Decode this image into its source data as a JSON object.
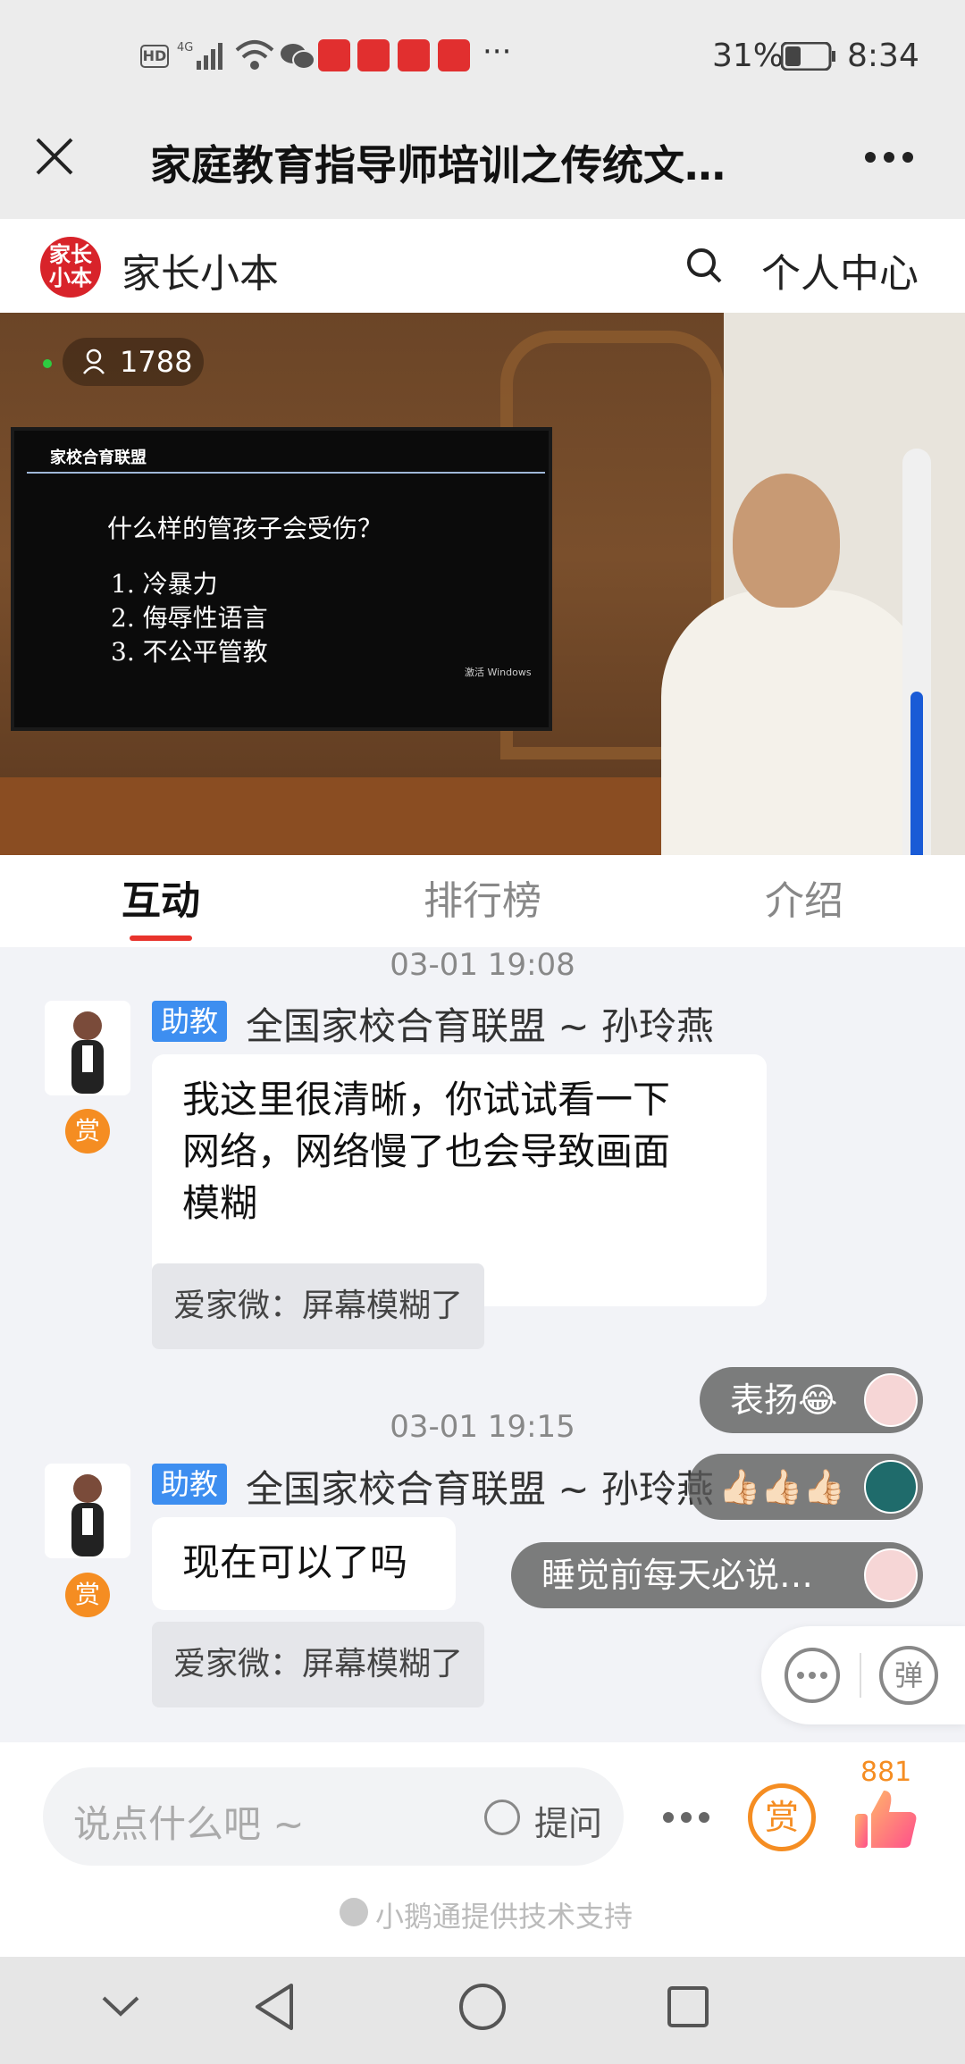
{
  "status": {
    "battery": "31%",
    "time": "8:34",
    "more": "···",
    "hd": "HD",
    "net": "4G"
  },
  "titlebar": {
    "title": "家庭教育指导师培训之传统文…"
  },
  "app": {
    "name": "家长小本",
    "logo_text": "家长\n小本",
    "personal_center": "个人中心"
  },
  "video": {
    "viewer_count": "1788",
    "tv_brand": "家校合育联盟",
    "slide_question": "什么样的管孩子会受伤？",
    "slide_items": [
      "1. 冷暴力",
      "2. 侮辱性语言",
      "3. 不公平管教"
    ],
    "watermark": "激活 Windows"
  },
  "tabs": [
    {
      "label": "互动",
      "active": true
    },
    {
      "label": "排行榜",
      "active": false
    },
    {
      "label": "介绍",
      "active": false
    }
  ],
  "chat": {
    "messages": [
      {
        "timestamp": "03-01 19:08",
        "role": "助教",
        "sender": "全国家校合育联盟 ~ 孙玲燕",
        "reward": "赏",
        "text": [
          "我这里很清晰，你试试看一下",
          "网络，网络慢了也会导致画面",
          "模糊"
        ],
        "quote": "爱家微：屏幕模糊了"
      },
      {
        "timestamp": "03-01 19:15",
        "role": "助教",
        "sender": "全国家校合育联盟 ~ 孙玲燕",
        "reward": "赏",
        "text": [
          "现在可以了吗"
        ],
        "quote": "爱家微：屏幕模糊了"
      }
    ],
    "danmaku": [
      {
        "text": "表扬😂"
      },
      {
        "text": "👍🏻👍🏻👍🏻"
      },
      {
        "text": "睡觉前每天必说…"
      }
    ],
    "danmaku_toggle": "弹"
  },
  "input": {
    "placeholder": "说点什么吧 ~",
    "ask_label": "提问",
    "reward": "赏",
    "like_count": "881",
    "footer": "小鹅通提供技术支持"
  },
  "colors": {
    "accent": "#e8332c",
    "reward": "#f58d22",
    "badge": "#3d8ef0"
  }
}
